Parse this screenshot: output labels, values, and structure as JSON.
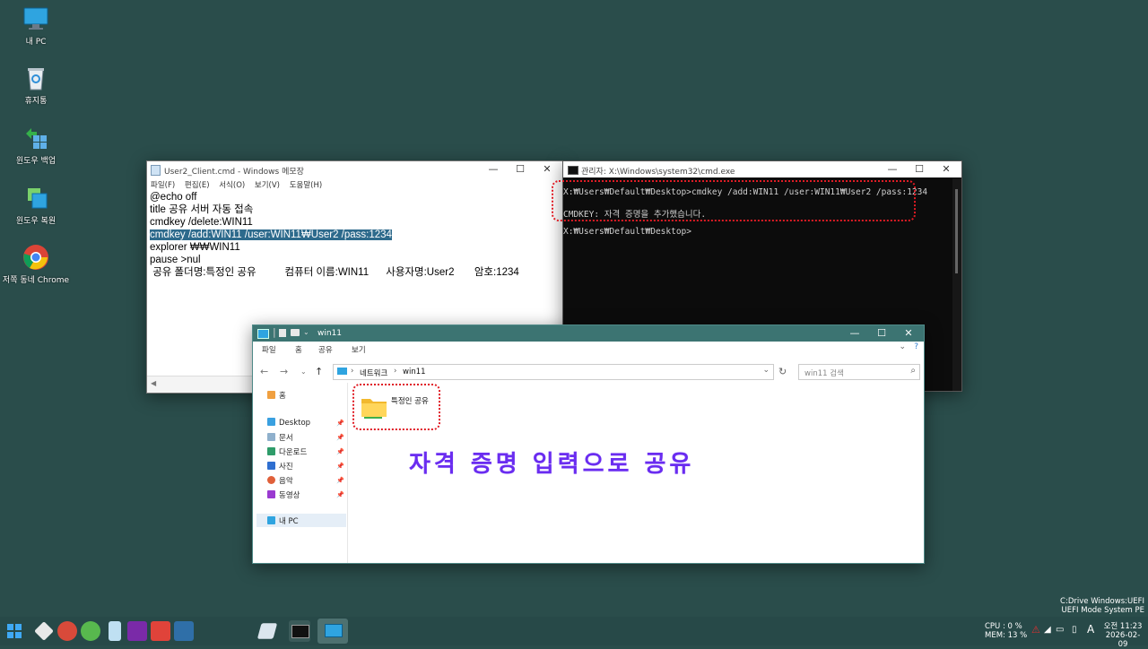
{
  "desktop": {
    "icons": [
      {
        "label": "내 PC"
      },
      {
        "label": "휴지통"
      },
      {
        "label": "윈도우 백업"
      },
      {
        "label": "윈도우 복원"
      },
      {
        "label": "저쪽 동네 Chrome"
      }
    ],
    "sysinfo": {
      "line1": "C:Drive Windows:UEFI",
      "line2": "UEFI Mode System PE"
    }
  },
  "notepad": {
    "title": "User2_Client.cmd - Windows 메모장",
    "menu": [
      "파일(F)",
      "편집(E)",
      "서식(O)",
      "보기(V)",
      "도움말(H)"
    ],
    "lines": [
      "@echo off",
      "title 공유 서버 자동 접속",
      "cmdkey /delete:WIN11",
      "cmdkey /add:WIN11 /user:WIN11₩User2 /pass:1234",
      "explorer ₩₩WIN11",
      "pause >nul",
      " 공유 폴더명:특정인 공유          컴퓨터 이름:WIN11      사용자명:User2       암호:1234"
    ]
  },
  "cmd": {
    "title": "관리자: X:\\Windows\\system32\\cmd.exe",
    "lines": [
      "X:₩Users₩Default₩Desktop>cmdkey /add:WIN11 /user:WIN11₩User2 /pass:1234",
      "",
      "CMDKEY: 자격 증명을 추가했습니다.",
      "",
      "X:₩Users₩Default₩Desktop>"
    ]
  },
  "explorer": {
    "title": "win11",
    "ribbon": [
      "파일",
      "홈",
      "공유",
      "보기"
    ],
    "address": {
      "seg1": "네트워크",
      "seg2": "win11"
    },
    "search_placeholder": "win11 검색",
    "nav": {
      "home": "홈",
      "quick": [
        "Desktop",
        "문서",
        "다운로드",
        "사진",
        "음악",
        "동영상"
      ],
      "mypc": "내 PC"
    },
    "folder": {
      "name": "특정인 공유"
    }
  },
  "overlay": {
    "text": "자격 증명 입력으로 공유"
  },
  "taskbar": {
    "cpu": "CPU :   0 %",
    "mem": "MEM:  13 %",
    "ime": "A",
    "time": "오전 11:23",
    "date": "2026-02-09"
  },
  "colors": {
    "desktop": "#2a4d4b",
    "accent": "#3c7472",
    "highlight": "#e01b24",
    "overlay": "#6a2cf0"
  }
}
